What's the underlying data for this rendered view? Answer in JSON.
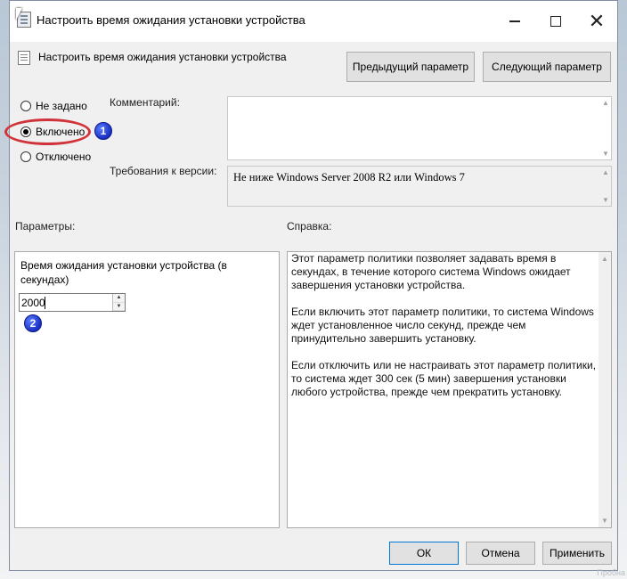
{
  "window": {
    "title": "Настроить время ожидания установки устройства",
    "controls": {
      "minimize": "minimize-icon",
      "maximize": "maximize-icon",
      "close": "✕"
    }
  },
  "header": {
    "title": "Настроить время ожидания установки устройства",
    "prev_button": "Предыдущий параметр",
    "next_button": "Следующий параметр"
  },
  "state": {
    "options": [
      {
        "label": "Не задано",
        "checked": false
      },
      {
        "label": "Включено",
        "checked": true
      },
      {
        "label": "Отключено",
        "checked": false
      }
    ]
  },
  "comment": {
    "label": "Комментарий:",
    "value": ""
  },
  "requirements": {
    "label": "Требования к версии:",
    "value": "Не ниже Windows Server 2008 R2 или Windows 7"
  },
  "params": {
    "label": "Параметры:",
    "field_label": "Время ожидания установки устройства (в секундах)",
    "value": "2000"
  },
  "help": {
    "label": "Справка:",
    "paragraphs": [
      "Этот параметр политики позволяет задавать время в секундах, в течение которого система Windows ожидает завершения установки устройства.",
      "Если включить этот параметр политики, то система Windows ждет установленное число секунд, прежде чем принудительно завершить установку.",
      "Если отключить или не настраивать этот параметр политики, то система ждет 300 сек (5 мин) завершения установки любого устройства, прежде чем прекратить установку."
    ]
  },
  "footer": {
    "ok": "ОК",
    "cancel": "Отмена",
    "apply": "Применить"
  },
  "annotations": {
    "badge1": "1",
    "badge2": "2",
    "highlight_color": "#d0343a",
    "badge_color": "#1a2fc2"
  },
  "watermark": "Пробна"
}
